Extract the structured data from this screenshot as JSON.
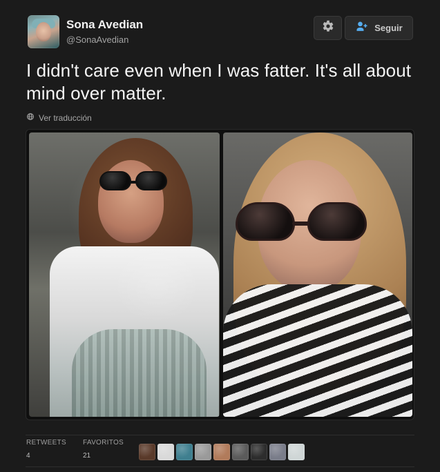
{
  "tweet": {
    "author": {
      "name": "Sona Avedian",
      "handle": "@SonaAvedian"
    },
    "buttons": {
      "follow_label": "Seguir"
    },
    "text": "I didn't care even when I was fatter. It's all about mind over matter.",
    "translate_label": "Ver traducción",
    "stats": {
      "retweets_label": "RETWEETS",
      "retweets_value": "4",
      "favorites_label": "FAVORITOS",
      "favorites_value": "21"
    },
    "favorite_avatars": [
      {
        "color": "#5a3a2a"
      },
      {
        "color": "#d9d9d9"
      },
      {
        "color": "#3f7f8f"
      },
      {
        "color": "#9a9a9a"
      },
      {
        "color": "#b17b5b"
      },
      {
        "color": "#5b5b5b"
      },
      {
        "color": "#2d2d2d"
      },
      {
        "color": "#7a7d8a"
      },
      {
        "color": "#cfd6d6"
      }
    ]
  }
}
